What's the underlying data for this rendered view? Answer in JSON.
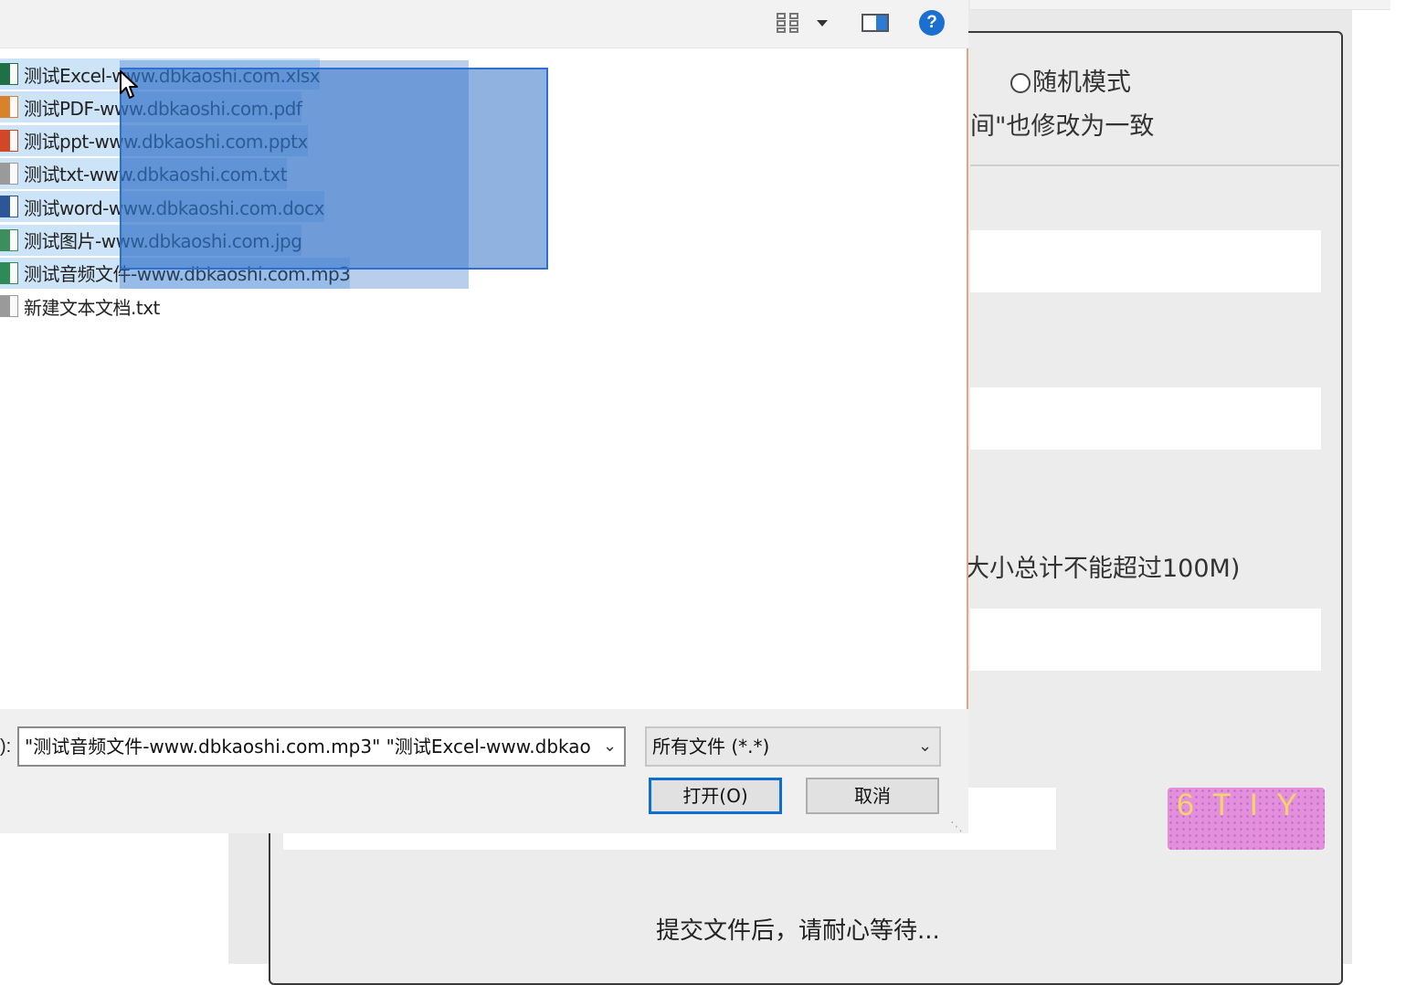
{
  "background_page": {
    "radio_label": "随机模式",
    "note_line": "间\"也修改为一致",
    "size_note": "大小总计不能超过100M)",
    "captcha_text": "6TIY",
    "wait_message": "提交文件后，请耐心等待..."
  },
  "dialog": {
    "toolbar": {
      "view_icon": "view-options-icon",
      "pane_icon": "preview-pane-icon",
      "help_glyph": "?"
    },
    "files": [
      {
        "name": "测试Excel-www.dbkaoshi.com.xlsx",
        "icon": "excel-file-icon",
        "color": "#1e7145",
        "selected": true
      },
      {
        "name": "测试PDF-www.dbkaoshi.com.pdf",
        "icon": "pdf-file-icon",
        "color": "#d9822b",
        "selected": true
      },
      {
        "name": "测试ppt-www.dbkaoshi.com.pptx",
        "icon": "ppt-file-icon",
        "color": "#d24726",
        "selected": true
      },
      {
        "name": "测试txt-www.dbkaoshi.com.txt",
        "icon": "text-file-icon",
        "color": "#9a9a9a",
        "selected": true
      },
      {
        "name": "测试word-www.dbkaoshi.com.docx",
        "icon": "word-file-icon",
        "color": "#2b579a",
        "selected": true
      },
      {
        "name": "测试图片-www.dbkaoshi.com.jpg",
        "icon": "image-file-icon",
        "color": "#3a8f5a",
        "selected": true
      },
      {
        "name": "测试音频文件-www.dbkaoshi.com.mp3",
        "icon": "audio-file-icon",
        "color": "#2e8b57",
        "selected": true
      },
      {
        "name": "新建文本文档.txt",
        "icon": "text-file-icon",
        "color": "#9a9a9a",
        "selected": false
      }
    ],
    "filename_label": "):",
    "filename_value": "\"测试音频文件-www.dbkaoshi.com.mp3\" \"测试Excel-www.dbkao",
    "filetype_value": "所有文件 (*.*)",
    "open_button": "打开(O)",
    "cancel_button": "取消"
  }
}
